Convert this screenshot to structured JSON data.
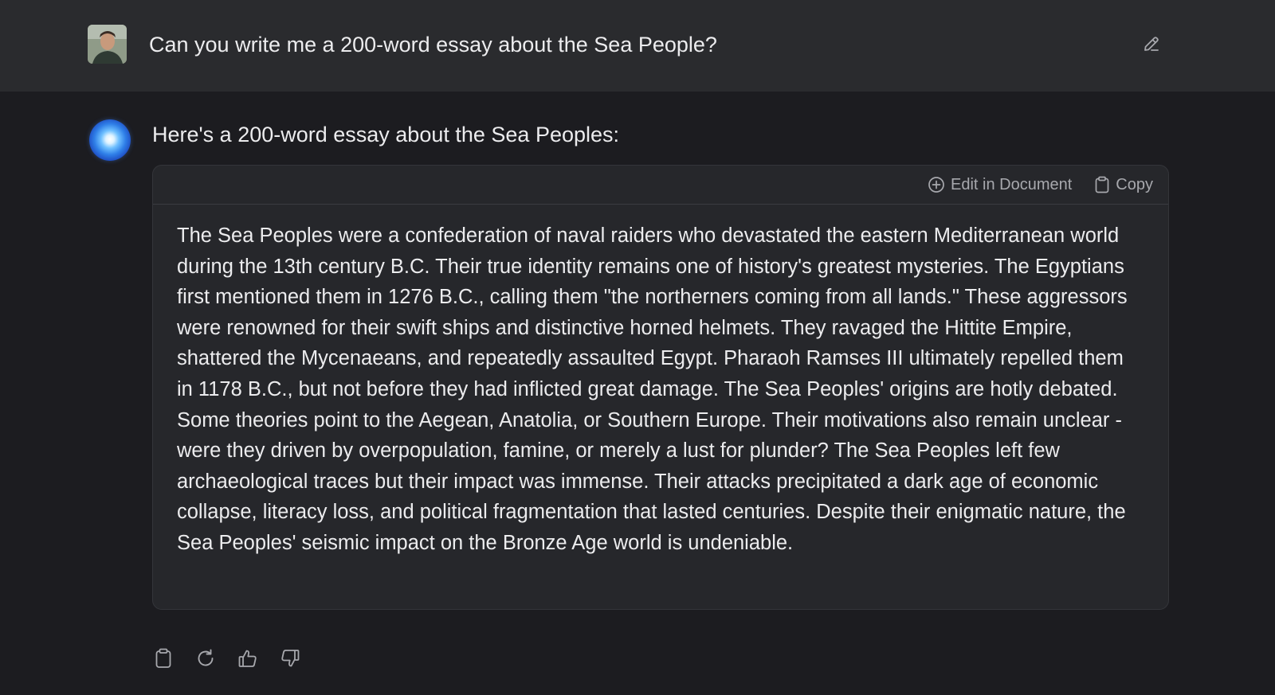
{
  "user_message": {
    "text": "Can you write me a 200-word essay about the Sea People?"
  },
  "assistant_message": {
    "intro": "Here's a 200-word essay about the Sea Peoples:",
    "card": {
      "edit_in_document_label": "Edit in Document",
      "copy_label": "Copy",
      "essay": "The Sea Peoples were a confederation of naval raiders who devastated the eastern Mediterranean world during the 13th century B.C. Their true identity remains one of history's greatest mysteries. The Egyptians first mentioned them in 1276 B.C., calling them \"the northerners coming from all lands.\" These aggressors were renowned for their swift ships and distinctive horned helmets. They ravaged the Hittite Empire, shattered the Mycenaeans, and repeatedly assaulted Egypt. Pharaoh Ramses III ultimately repelled them in 1178 B.C., but not before they had inflicted great damage. The Sea Peoples' origins are hotly debated. Some theories point to the Aegean, Anatolia, or Southern Europe. Their motivations also remain unclear - were they driven by overpopulation, famine, or merely a lust for plunder? The Sea Peoples left few archaeological traces but their impact was immense. Their attacks precipitated a dark age of economic collapse, literacy loss, and political fragmentation that lasted centuries. Despite their enigmatic nature, the Sea Peoples' seismic impact on the Bronze Age world is undeniable."
    }
  },
  "icons": {
    "edit": "pencil-icon",
    "plus_circle": "plus-circle-icon",
    "clipboard": "clipboard-icon",
    "retry": "refresh-icon",
    "thumbs_up": "thumbs-up-icon",
    "thumbs_down": "thumbs-down-icon"
  },
  "colors": {
    "background": "#1c1c20",
    "user_row": "#2a2b2e",
    "card": "#26272b",
    "text": "#ececee",
    "muted": "#a7a8ad"
  }
}
